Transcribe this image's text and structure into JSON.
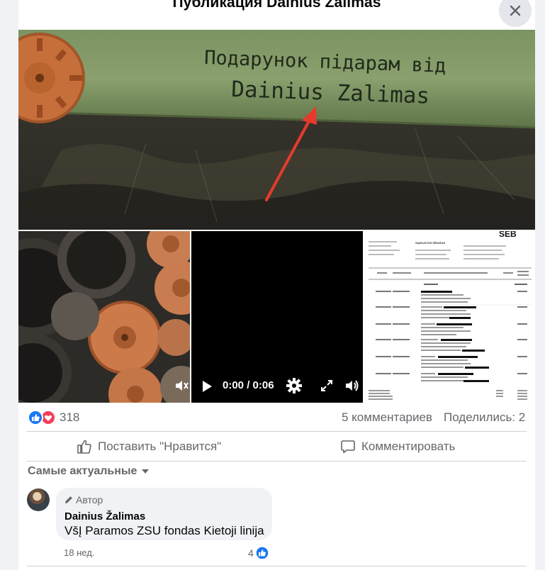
{
  "header": {
    "title": "Публикация Dainius Zalimas",
    "close_icon": "close-icon"
  },
  "media": {
    "main_photo": {
      "handwriting_line1": "Подарунок підарам від",
      "handwriting_line2": "Dainius Zalimas"
    },
    "video": {
      "time": "0:00 / 0:06",
      "icons": [
        "play-icon",
        "gear-icon",
        "fullscreen-icon",
        "volume-icon"
      ]
    },
    "invoice": {
      "bank": "SEB",
      "heading": "SĄSKAITOS IŠRAŠAS",
      "rows": [
        "2023-05-10",
        "2023-05-13",
        "2023-05-17",
        "2023-05-20",
        "2023-05-22",
        "2023-05-27"
      ]
    }
  },
  "stats": {
    "reactions_count": "318",
    "comments": "5 комментариев",
    "shares": "Поделились: 2"
  },
  "actions": {
    "like": "Поставить \"Нравится\"",
    "comment": "Комментировать"
  },
  "sort": {
    "label": "Самые актуальные"
  },
  "comment": {
    "badge": "Автор",
    "author": "Dainius Žalimas",
    "text": "VšĮ Paramos ZSU fondas Kietoji linija",
    "time": "18 нед.",
    "likes": "4"
  },
  "colors": {
    "like_blue": "#1877f2",
    "love_red": "#f33e58",
    "muted": "#65676b",
    "arrow_red": "#e53b2c"
  }
}
